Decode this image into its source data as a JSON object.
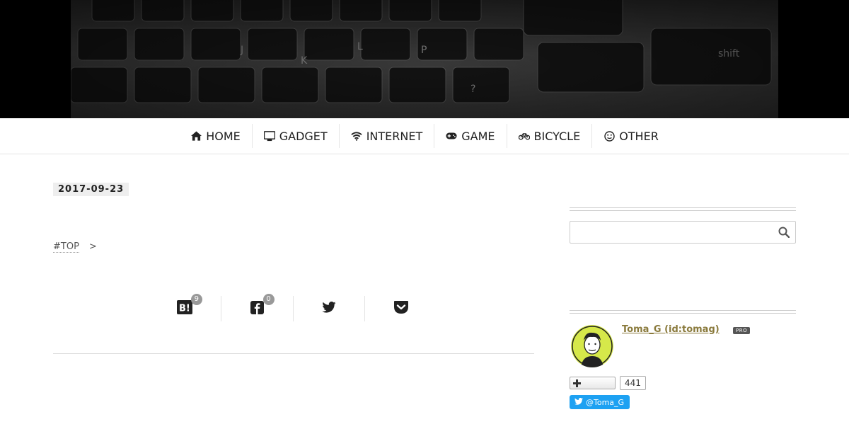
{
  "header": {
    "title": "",
    "description": ""
  },
  "nav": {
    "items": [
      {
        "label": "HOME",
        "icon": "home-icon"
      },
      {
        "label": "GADGET",
        "icon": "monitor-icon"
      },
      {
        "label": "INTERNET",
        "icon": "wifi-icon"
      },
      {
        "label": "GAME",
        "icon": "gamepad-icon"
      },
      {
        "label": "BICYCLE",
        "icon": "bicycle-icon"
      },
      {
        "label": "OTHER",
        "icon": "smile-icon"
      }
    ]
  },
  "article": {
    "date": "2017-09-23",
    "title": "",
    "breadcrumb": {
      "top": "#TOP",
      "separator": ">",
      "category": ""
    },
    "share": {
      "caption": "",
      "hatena_count": "9",
      "facebook_count": "0"
    },
    "paragraphs": [
      "",
      "",
      ""
    ]
  },
  "sidebar": {
    "search_heading": "",
    "profile_heading": "",
    "profile": {
      "name": "Toma_G (id:tomag)",
      "badge": "PRO",
      "meta": ""
    },
    "follow_count": "441",
    "twitter_label": "@Toma_G"
  },
  "colors": {
    "twitter": "#1da1f2",
    "profile_link": "#8a7a3c",
    "avatar_bg": "#d6e84a"
  }
}
